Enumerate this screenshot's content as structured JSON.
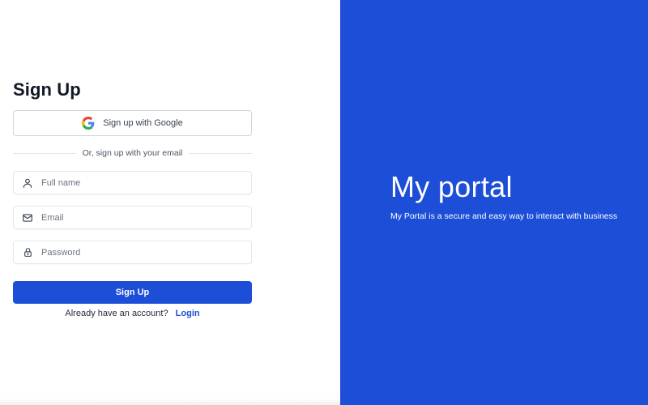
{
  "form": {
    "title": "Sign Up",
    "google_button_label": "Sign up with Google",
    "divider_text": "Or, sign up with your email",
    "fields": {
      "full_name": {
        "placeholder": "Full name",
        "icon": "user-icon"
      },
      "email": {
        "placeholder": "Email",
        "icon": "mail-icon"
      },
      "password": {
        "placeholder": "Password",
        "icon": "lock-icon"
      }
    },
    "submit_label": "Sign Up",
    "login_prompt": "Already have an account?",
    "login_link": "Login"
  },
  "brand": {
    "title": "My portal",
    "subtitle": "My Portal is a secure and easy way to interact with business"
  },
  "colors": {
    "primary": "#1d4ed8",
    "panel_text": "#ffffff",
    "border": "#e5e7eb"
  }
}
